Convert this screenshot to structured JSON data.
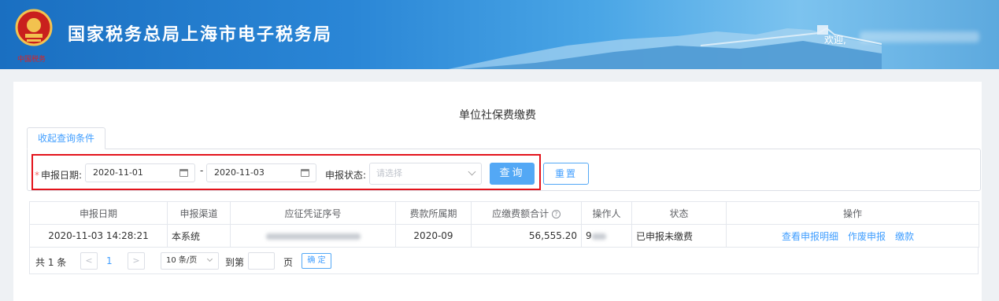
{
  "header": {
    "site_title": "国家税务总局上海市电子税务局",
    "welcome": "欢迎,",
    "colors": {
      "header_start": "#1a6fc1",
      "header_end": "#7cc3ef"
    }
  },
  "page": {
    "title": "单位社保费缴费"
  },
  "filter": {
    "tab_label": "收起查询条件",
    "date_label": "申报日期:",
    "date_from": "2020-11-01",
    "date_separator": "-",
    "date_to": "2020-11-03",
    "status_label": "申报状态:",
    "status_placeholder": "请选择",
    "query_button": "查询",
    "reset_button": "重置"
  },
  "table": {
    "columns": [
      "申报日期",
      "申报渠道",
      "应征凭证序号",
      "费款所属期",
      "应缴费额合计",
      "操作人",
      "状态",
      "操作"
    ],
    "rows": [
      {
        "date": "2020-11-03 14:28:21",
        "channel": "本系统",
        "voucher": "",
        "period": "2020-09",
        "amount": "56,555.20",
        "operator": "9",
        "status": "已申报未缴费",
        "actions": [
          "查看申报明细",
          "作废申报",
          "缴款"
        ]
      }
    ]
  },
  "pagination": {
    "total": "共 1 条",
    "prev": "<",
    "current_page": "1",
    "next": ">",
    "page_size": "10 条/页",
    "goto_label": "到第",
    "page_unit": "页",
    "confirm": "确 定"
  },
  "icons": {
    "calendar": "calendar-icon",
    "chevron": "chevron-down-icon",
    "help": "question-circle-icon",
    "emblem": "tax-emblem-icon"
  }
}
